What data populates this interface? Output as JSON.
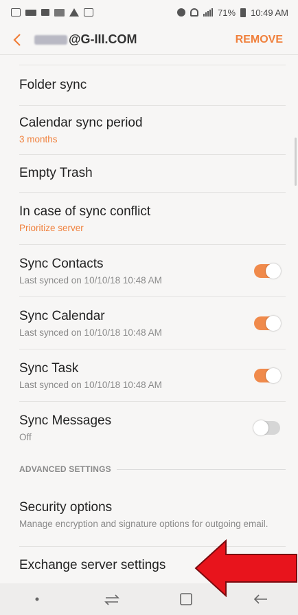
{
  "status_bar": {
    "battery": "71%",
    "time": "10:49 AM"
  },
  "header": {
    "account": "@G-III.COM",
    "remove_label": "REMOVE"
  },
  "settings": [
    {
      "title": "Folder sync",
      "subtitle": "",
      "toggle": null
    },
    {
      "title": "Calendar sync period",
      "subtitle": "3 months",
      "subtitle_accent": true,
      "toggle": null
    },
    {
      "title": "Empty Trash",
      "subtitle": "",
      "toggle": null
    },
    {
      "title": "In case of sync conflict",
      "subtitle": "Prioritize server",
      "subtitle_accent": true,
      "toggle": null
    },
    {
      "title": "Sync Contacts",
      "subtitle": "Last synced on 10/10/18  10:48 AM",
      "toggle": "on"
    },
    {
      "title": "Sync Calendar",
      "subtitle": "Last synced on 10/10/18  10:48 AM",
      "toggle": "on"
    },
    {
      "title": "Sync Task",
      "subtitle": "Last synced on 10/10/18  10:48 AM",
      "toggle": "on"
    },
    {
      "title": "Sync Messages",
      "subtitle": "Off",
      "toggle": "off"
    }
  ],
  "advanced": {
    "header": "ADVANCED SETTINGS",
    "items": [
      {
        "title": "Security options",
        "subtitle": "Manage encryption and signature options for outgoing email."
      },
      {
        "title": "Exchange server settings",
        "subtitle": ""
      }
    ]
  },
  "colors": {
    "accent": "#f0803c",
    "toggle_on": "#f08a4b",
    "annotation_arrow": "#e8141c"
  },
  "icons": [
    "back-chevron-icon",
    "recent-apps-icon",
    "home-icon",
    "back-arrow-icon"
  ]
}
